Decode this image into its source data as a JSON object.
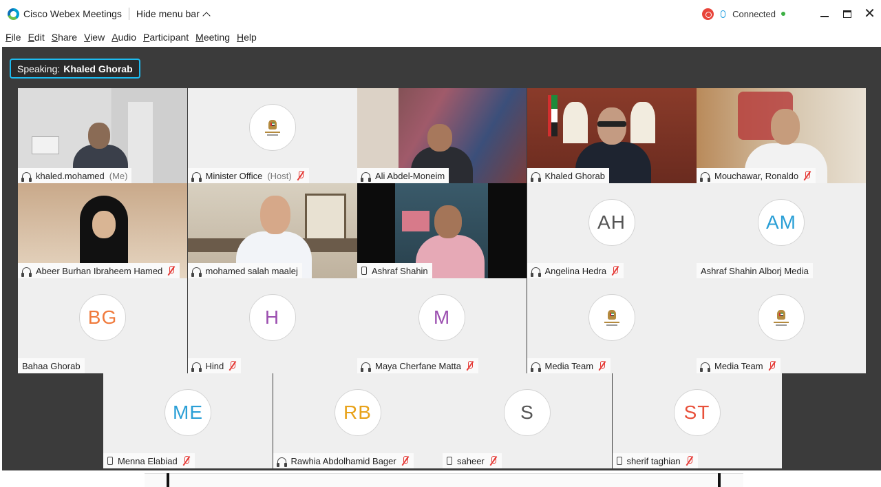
{
  "window": {
    "app_title": "Cisco Webex Meetings",
    "hide_menu_label": "Hide menu bar",
    "connection_status": "Connected",
    "colors": {
      "accent": "#19b1e6",
      "record": "#e8443a",
      "connected": "#3cb043",
      "muted": "#e53935"
    }
  },
  "menu": {
    "items": [
      {
        "accel": "F",
        "rest": "ile"
      },
      {
        "accel": "E",
        "rest": "dit"
      },
      {
        "accel": "S",
        "rest": "hare"
      },
      {
        "accel": "V",
        "rest": "iew"
      },
      {
        "accel": "A",
        "rest": "udio"
      },
      {
        "accel": "P",
        "rest": "articipant"
      },
      {
        "accel": "M",
        "rest": "eeting"
      },
      {
        "accel": "H",
        "rest": "elp"
      }
    ]
  },
  "speaking": {
    "prefix": "Speaking:",
    "name": "Khaled Ghorab"
  },
  "participants": [
    {
      "name": "khaled.mohamed",
      "role": "(Me)",
      "audio": "headset",
      "muted": false,
      "view": "video"
    },
    {
      "name": "Minister Office",
      "role": "(Host)",
      "audio": "headset",
      "muted": true,
      "view": "logo"
    },
    {
      "name": "Ali Abdel-Moneim",
      "role": "",
      "audio": "headset",
      "muted": false,
      "view": "video"
    },
    {
      "name": "Khaled Ghorab",
      "role": "",
      "audio": "headset",
      "muted": false,
      "view": "video",
      "active": true
    },
    {
      "name": "Mouchawar, Ronaldo",
      "role": "",
      "audio": "headset",
      "muted": true,
      "view": "video"
    },
    {
      "name": "Abeer Burhan Ibraheem Hamed",
      "role": "",
      "audio": "headset",
      "muted": true,
      "view": "video"
    },
    {
      "name": "mohamed salah maalej",
      "role": "",
      "audio": "headset",
      "muted": false,
      "view": "video"
    },
    {
      "name": "Ashraf Shahin",
      "role": "",
      "audio": "phone",
      "muted": false,
      "view": "video"
    },
    {
      "name": "Angelina Hedra",
      "role": "",
      "audio": "headset",
      "muted": true,
      "view": "avatar",
      "initials": "AH",
      "color": "#555555"
    },
    {
      "name": "Ashraf Shahin Alborj Media",
      "role": "",
      "audio": "none",
      "muted": false,
      "view": "avatar",
      "initials": "AM",
      "color": "#2a9fd6"
    },
    {
      "name": "Bahaa Ghorab",
      "role": "",
      "audio": "none",
      "muted": false,
      "view": "avatar",
      "initials": "BG",
      "color": "#f07a3c"
    },
    {
      "name": "Hind",
      "role": "",
      "audio": "headset",
      "muted": true,
      "view": "avatar",
      "initials": "H",
      "color": "#9c4fb0"
    },
    {
      "name": "Maya Cherfane Matta",
      "role": "",
      "audio": "headset",
      "muted": true,
      "view": "avatar",
      "initials": "M",
      "color": "#9c4fb0"
    },
    {
      "name": "Media Team",
      "role": "",
      "audio": "headset",
      "muted": true,
      "view": "logo"
    },
    {
      "name": "Media Team",
      "role": "",
      "audio": "headset",
      "muted": true,
      "view": "logo"
    },
    {
      "name": "Menna Elabiad",
      "role": "",
      "audio": "phone",
      "muted": true,
      "view": "avatar",
      "initials": "ME",
      "color": "#2a9fd6"
    },
    {
      "name": "Rawhia Abdolhamid Bager",
      "role": "",
      "audio": "headset",
      "muted": true,
      "view": "avatar",
      "initials": "RB",
      "color": "#e8a21a"
    },
    {
      "name": "saheer",
      "role": "",
      "audio": "phone",
      "muted": true,
      "view": "avatar",
      "initials": "S",
      "color": "#555555"
    },
    {
      "name": "sherif taghian",
      "role": "",
      "audio": "phone",
      "muted": true,
      "view": "avatar",
      "initials": "ST",
      "color": "#e8503a"
    }
  ]
}
